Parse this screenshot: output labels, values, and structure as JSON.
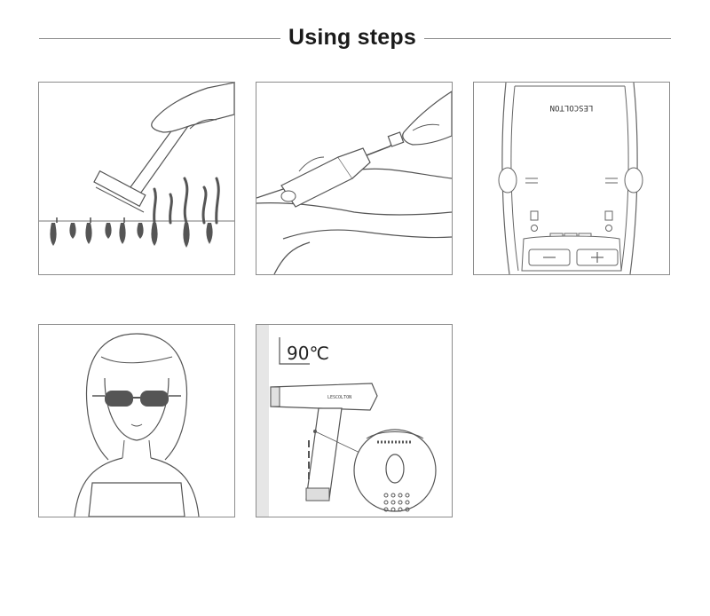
{
  "heading": {
    "title": "Using steps"
  },
  "panels": [
    {
      "name": "shave-hair"
    },
    {
      "name": "connect-device"
    },
    {
      "name": "device-controls",
      "brand": "LESCOLTON"
    },
    {
      "name": "wear-goggles"
    },
    {
      "name": "hold-90-degrees",
      "angle_label": "90℃",
      "brand": "LESCOLTON"
    }
  ]
}
